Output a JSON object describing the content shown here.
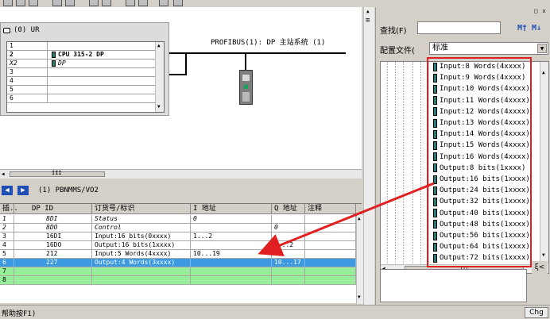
{
  "rack": {
    "title": "(0) UR",
    "rows": [
      {
        "slot": "1",
        "module": ""
      },
      {
        "slot": "2",
        "module": "CPU 315-2 DP"
      },
      {
        "slot": "X2",
        "module": "DP"
      },
      {
        "slot": "3",
        "module": ""
      },
      {
        "slot": "4",
        "module": ""
      },
      {
        "slot": "5",
        "module": ""
      },
      {
        "slot": "6",
        "module": ""
      }
    ]
  },
  "network": {
    "bus_label": "PROFIBUS(1): DP 主站系统 (1)"
  },
  "detail": {
    "title": "(1)   PBNMMS/VO2",
    "columns": [
      "插..",
      "DP ID",
      "订货号/标识",
      "I 地址",
      "Q 地址",
      "注释"
    ],
    "rows": [
      {
        "slot": "1",
        "dpid": "8DI",
        "order": "Status",
        "i": "0",
        "q": ""
      },
      {
        "slot": "2",
        "dpid": "8DO",
        "order": "Control",
        "i": "",
        "q": "0"
      },
      {
        "slot": "3",
        "dpid": "16DI",
        "order": "Input:16 bits(0xxxx)",
        "i": "1...2",
        "q": ""
      },
      {
        "slot": "4",
        "dpid": "16DO",
        "order": "Output:16 bits(1xxxx)",
        "i": "",
        "q": "1...2"
      },
      {
        "slot": "5",
        "dpid": "212",
        "order": "Input:5 Words(4xxxx)",
        "i": "10...19",
        "q": ""
      },
      {
        "slot": "6",
        "dpid": "227",
        "order": "Output:4 Words(3xxxx)",
        "i": "",
        "q": "10...17"
      },
      {
        "slot": "7",
        "dpid": "",
        "order": "",
        "i": "",
        "q": ""
      },
      {
        "slot": "8",
        "dpid": "",
        "order": "",
        "i": "",
        "q": ""
      }
    ]
  },
  "catalog": {
    "close_label": "□ x",
    "find_label": "查找(F)",
    "find_buttons": "M† M↓",
    "profile_label": "配置文件(",
    "profile_value": "标准",
    "items": [
      "Input:8 Words(4xxxx)",
      "Input:9 Words(4xxxx)",
      "Input:10 Words(4xxxx)",
      "Input:11 Words(4xxxx)",
      "Input:12 Words(4xxxx)",
      "Input:13 Words(4xxxx)",
      "Input:14 Words(4xxxx)",
      "Input:15 Words(4xxxx)",
      "Input:16 Words(4xxxx)",
      "Output:8 bits(1xxxx)",
      "Output:16 bits(1xxxx)",
      "Output:24 bits(1xxxx)",
      "Output:32 bits(1xxxx)",
      "Output:40 bits(1xxxx)",
      "Output:48 bits(1xxxx)",
      "Output:56 bits(1xxxx)",
      "Output:64 bits(1xxxx)",
      "Output:72 bits(1xxxx)"
    ],
    "info_button": "ξ<"
  },
  "status": {
    "left": "帮助按F1)",
    "right": "Chg"
  },
  "colors": {
    "selected_row": "#3d9ae0",
    "empty_rows": "#99ee99",
    "highlight_box": "#e02020"
  }
}
